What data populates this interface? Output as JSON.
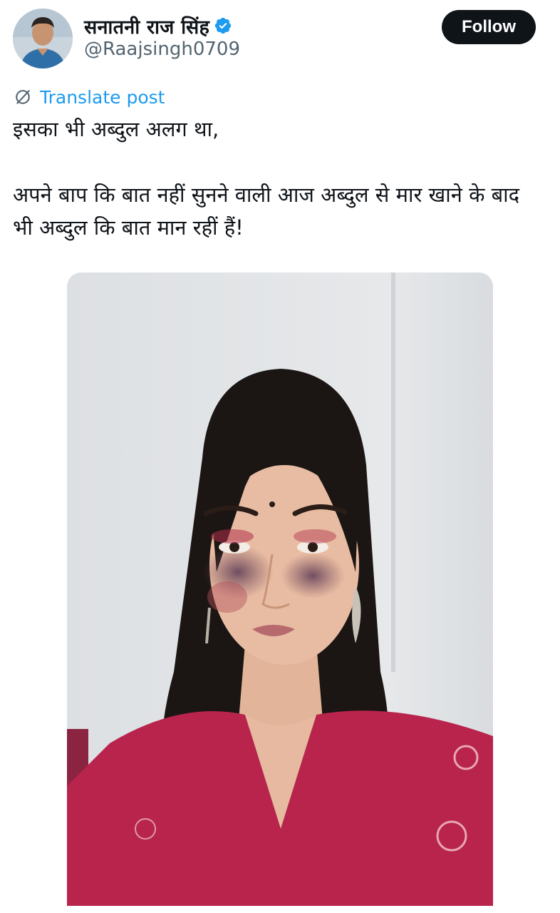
{
  "author": {
    "display_name": "सनातनी राज सिंह",
    "handle": "@Raajsingh0709",
    "verified": true,
    "avatar_icon": "profile-photo"
  },
  "actions": {
    "follow_label": "Follow"
  },
  "translate": {
    "label": "Translate post",
    "icon": "translate-icon"
  },
  "post": {
    "line1": "इसका भी अब्दुल अलग था,",
    "line2": "अपने बाप कि बात नहीं सुनने वाली आज अब्दुल से मार खाने के बाद",
    "line3": "भी अब्दुल कि बात मान रहीं हैं!"
  },
  "media": {
    "type": "photo"
  },
  "colors": {
    "accent": "#1d9bf0",
    "follow_bg": "#0f1419",
    "text": "#0f1419",
    "secondary": "#536471"
  }
}
